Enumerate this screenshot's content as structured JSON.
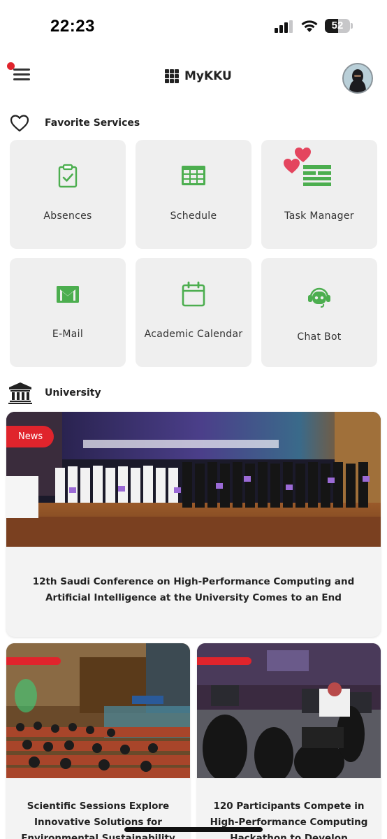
{
  "status_bar": {
    "time": "22:23",
    "battery": "52",
    "battery_level": 0.52
  },
  "header": {
    "app_name": "MyKKU",
    "menu_icon": "menu-icon",
    "notification_dot_color": "#e0242c"
  },
  "favorites": {
    "title": "Favorite Services",
    "icon": "heart-icon",
    "accent_color": "#4cae4f",
    "items": [
      {
        "label": "Absences",
        "icon": "clipboard-check-icon"
      },
      {
        "label": "Schedule",
        "icon": "table-icon"
      },
      {
        "label": "Task Manager",
        "icon": "task-list-hearts-icon"
      },
      {
        "label": "E-Mail",
        "icon": "mail-icon"
      },
      {
        "label": "Academic Calendar",
        "icon": "calendar-icon"
      },
      {
        "label": "Chat Bot",
        "icon": "chatbot-icon"
      }
    ]
  },
  "university": {
    "title": "University",
    "icon": "university-icon",
    "featured": {
      "badge": "News",
      "title": "12th Saudi Conference on High-Performance Computing and Artificial Intelligence at the University Comes to an End"
    },
    "cards": [
      {
        "title": "Scientific Sessions Explore Innovative Solutions for Environmental Sustainability"
      },
      {
        "title": "120 Participants Compete in High-Performance Computing Hackathon to Develop"
      }
    ],
    "badge_color": "#e0242c"
  }
}
